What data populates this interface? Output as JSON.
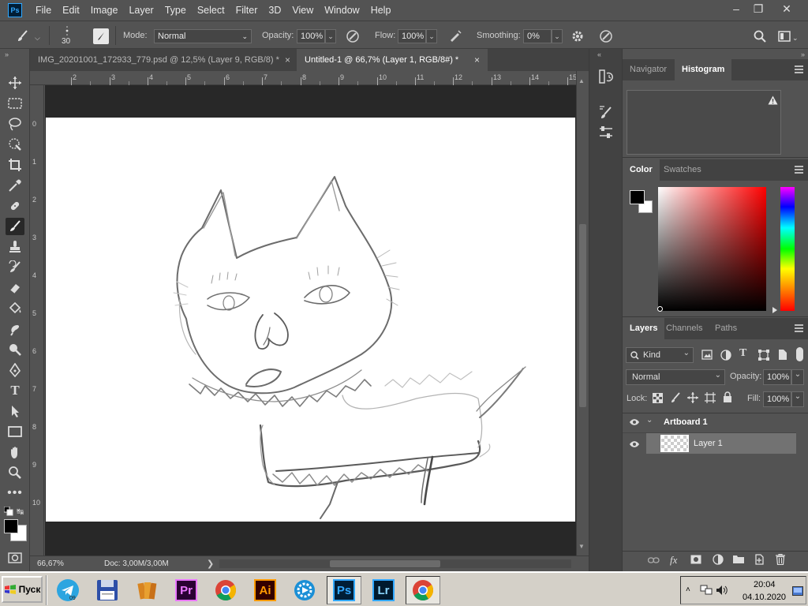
{
  "app": {
    "logo_text": "Ps"
  },
  "menu": [
    "File",
    "Edit",
    "Image",
    "Layer",
    "Type",
    "Select",
    "Filter",
    "3D",
    "View",
    "Window",
    "Help"
  ],
  "window_controls": {
    "minimize": "–",
    "restore": "❐",
    "close": "✕"
  },
  "options": {
    "brush_size": "30",
    "mode_label": "Mode:",
    "mode_value": "Normal",
    "opacity_label": "Opacity:",
    "opacity_value": "100%",
    "flow_label": "Flow:",
    "flow_value": "100%",
    "smoothing_label": "Smoothing:",
    "smoothing_value": "0%"
  },
  "tabs": [
    {
      "title": "IMG_20201001_172933_779.psd @ 12,5% (Layer 9, RGB/8) *",
      "close": "×",
      "active": false
    },
    {
      "title": "Untitled-1 @ 66,7% (Layer 1, RGB/8#) *",
      "close": "×",
      "active": true
    }
  ],
  "ruler": {
    "h": [
      "2",
      "3",
      "4",
      "5",
      "6",
      "7",
      "8",
      "9",
      "10",
      "11",
      "12",
      "13",
      "14",
      "15"
    ],
    "v": [
      "0",
      "1",
      "2",
      "3",
      "4",
      "5",
      "6",
      "7",
      "8",
      "9",
      "10"
    ]
  },
  "status": {
    "zoom": "66,67%",
    "doc": "Doc: 3,00M/3,00M",
    "arrow": "❯"
  },
  "panels": {
    "top_tabs": [
      "Navigator",
      "Histogram"
    ],
    "color_tabs": [
      "Color",
      "Swatches"
    ],
    "layer_tabs": [
      "Layers",
      "Channels",
      "Paths"
    ],
    "kind_label": "Kind",
    "blend_mode": "Normal",
    "opacity_label": "Opacity:",
    "opacity_value": "100%",
    "lock_label": "Lock:",
    "fill_label": "Fill:",
    "fill_value": "100%",
    "artboard_name": "Artboard 1",
    "layer_name": "Layer 1"
  },
  "taskbar": {
    "start_label": "Пуск",
    "apps": [
      "telegram",
      "floppy",
      "archiver",
      "premiere",
      "chrome",
      "illustrator",
      "video-tool",
      "photoshop",
      "lightroom",
      "chrome-2"
    ],
    "pr_label": "Pr",
    "ai_label": "Ai",
    "ps_label": "Ps",
    "lr_label": "Lr",
    "telegram_badge": "09",
    "time": "20:04",
    "date": "04.10.2020"
  },
  "colors": {
    "ui_bg": "#535353",
    "accent_blue": "#31a8ff",
    "foreground": "#000000",
    "background": "#ffffff"
  }
}
